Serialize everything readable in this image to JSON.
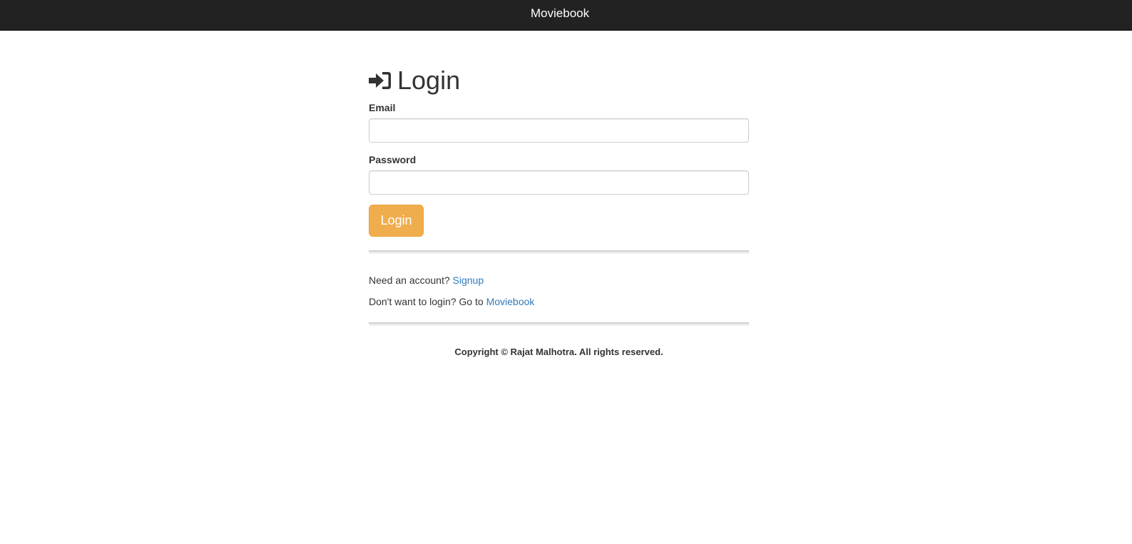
{
  "navbar": {
    "brand": "Moviebook"
  },
  "page": {
    "title": "Login",
    "title_icon": "sign-in-icon"
  },
  "form": {
    "email_label": "Email",
    "email_value": "",
    "email_placeholder": "",
    "password_label": "Password",
    "password_value": "",
    "password_placeholder": "",
    "submit_label": "Login"
  },
  "links": {
    "signup_prompt": "Need an account?",
    "signup_link": "Signup",
    "guest_prompt": "Don't want to login? Go to",
    "guest_link": "Moviebook"
  },
  "footer": {
    "copyright": "Copyright © Rajat Malhotra. All rights reserved."
  },
  "colors": {
    "navbar_bg": "#222222",
    "button_warning": "#f0ad4e",
    "link": "#337ab7"
  }
}
